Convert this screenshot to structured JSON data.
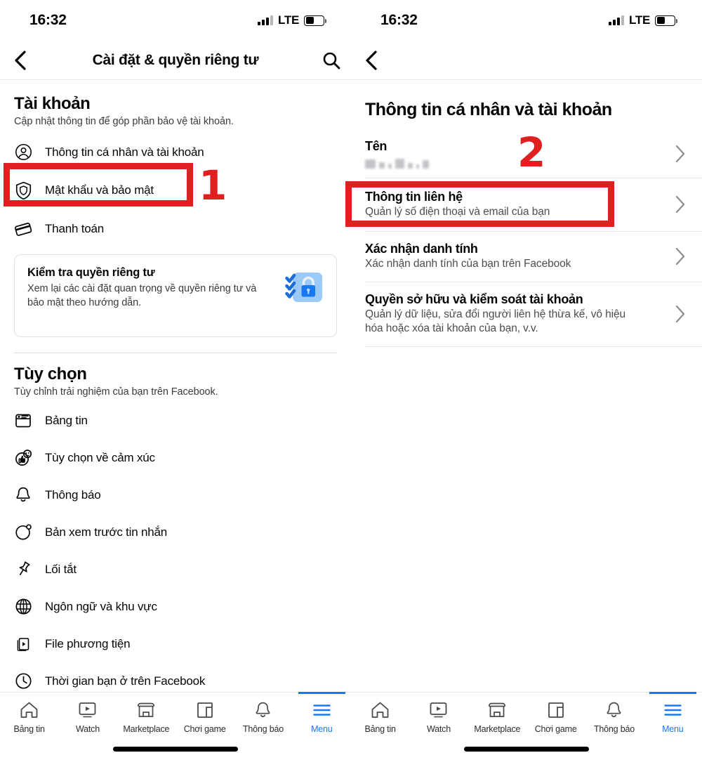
{
  "status_bar": {
    "time": "16:32",
    "network": "LTE",
    "signal_icon": "signal-bars-icon",
    "battery_icon": "battery-icon"
  },
  "left_screen": {
    "nav": {
      "back_icon": "chevron-left-icon",
      "title": "Cài đặt & quyền riêng tư",
      "search_icon": "search-icon"
    },
    "account_section": {
      "title": "Tài khoản",
      "subtitle": "Cập nhật thông tin để góp phần bảo vệ tài khoản.",
      "items": [
        {
          "label": "Thông tin cá nhân và tài khoản",
          "icon": "person-circle-icon"
        },
        {
          "label": "Mật khẩu và bảo mật",
          "icon": "shield-icon"
        },
        {
          "label": "Thanh toán",
          "icon": "credit-card-icon"
        }
      ]
    },
    "privacy_card": {
      "title": "Kiểm tra quyền riêng tư",
      "subtitle": "Xem lại các cài đặt quan trọng về quyền riêng tư và bảo mật theo hướng dẫn.",
      "icon": "privacy-checkup-lock-icon"
    },
    "preferences_section": {
      "title": "Tùy chọn",
      "subtitle": "Tùy chỉnh trải nghiệm của bạn trên Facebook.",
      "items": [
        {
          "label": "Bảng tin",
          "icon": "newsfeed-icon"
        },
        {
          "label": "Tùy chọn về cảm xúc",
          "icon": "reaction-thumbsup-icon"
        },
        {
          "label": "Thông báo",
          "icon": "bell-icon"
        },
        {
          "label": "Bản xem trước tin nhắn",
          "icon": "message-circle-icon"
        },
        {
          "label": "Lối tắt",
          "icon": "pin-icon"
        },
        {
          "label": "Ngôn ngữ và khu vực",
          "icon": "globe-icon"
        },
        {
          "label": "File phương tiện",
          "icon": "media-file-icon"
        },
        {
          "label": "Thời gian bạn ở trên Facebook",
          "icon": "clock-icon"
        }
      ]
    },
    "annotation": {
      "number": "1",
      "color": "#e02020",
      "target": "Mật khẩu và bảo mật"
    }
  },
  "right_screen": {
    "nav": {
      "back_icon": "chevron-left-icon"
    },
    "title": "Thông tin cá nhân và tài khoản",
    "rows": [
      {
        "title": "Tên",
        "subtitle": "",
        "redacted_value": true,
        "chevron": "chevron-right-icon"
      },
      {
        "title": "Thông tin liên hệ",
        "subtitle": "Quản lý số điện thoại và email của bạn",
        "redacted_value": false,
        "chevron": "chevron-right-icon"
      },
      {
        "title": "Xác nhận danh tính",
        "subtitle": "Xác nhận danh tính của bạn trên Facebook",
        "redacted_value": false,
        "chevron": "chevron-right-icon"
      },
      {
        "title": "Quyền sở hữu và kiểm soát tài khoản",
        "subtitle": "Quản lý dữ liệu, sửa đổi người liên hệ thừa kế, vô hiệu hóa hoặc xóa tài khoản của bạn, v.v.",
        "redacted_value": false,
        "chevron": "chevron-right-icon"
      }
    ],
    "annotation": {
      "number": "2",
      "color": "#e02020",
      "target": "Thông tin liên hệ"
    }
  },
  "tab_bar": {
    "active_color": "#1778f2",
    "tabs": [
      {
        "label": "Bảng tin",
        "icon": "home-icon",
        "active": false
      },
      {
        "label": "Watch",
        "icon": "video-icon",
        "active": false
      },
      {
        "label": "Marketplace",
        "icon": "store-icon",
        "active": false
      },
      {
        "label": "Chơi game",
        "icon": "gaming-icon",
        "active": false
      },
      {
        "label": "Thông báo",
        "icon": "bell-icon",
        "active": false
      },
      {
        "label": "Menu",
        "icon": "hamburger-icon",
        "active": true
      }
    ]
  }
}
